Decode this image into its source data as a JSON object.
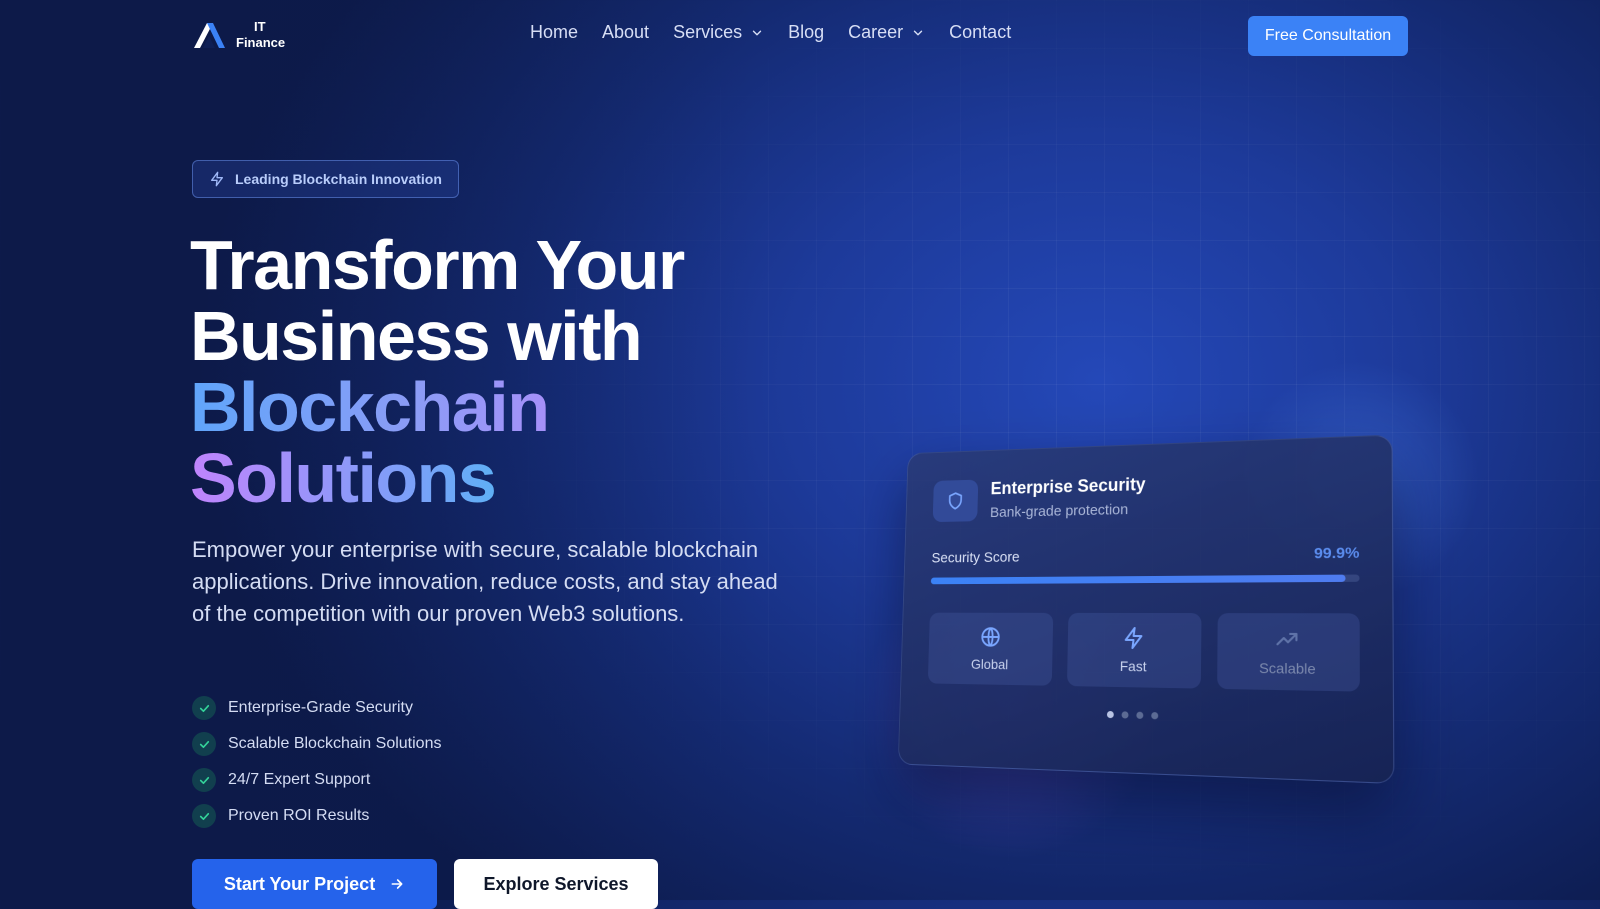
{
  "brand": {
    "line1": "IT",
    "line2": "Finance"
  },
  "nav": {
    "items": [
      {
        "label": "Home",
        "dropdown": false
      },
      {
        "label": "About",
        "dropdown": false
      },
      {
        "label": "Services",
        "dropdown": true
      },
      {
        "label": "Blog",
        "dropdown": false
      },
      {
        "label": "Career",
        "dropdown": true
      },
      {
        "label": "Contact",
        "dropdown": false
      }
    ],
    "cta_label": "Free Consultation"
  },
  "hero": {
    "badge": "Leading Blockchain Innovation",
    "headline": {
      "line1": "Transform Your",
      "line2": "Business with",
      "line3": "Blockchain",
      "line4": "Solutions"
    },
    "subtext": "Empower your enterprise with secure, scalable blockchain applications. Drive innovation, reduce costs, and stay ahead of the competition with our proven Web3 solutions.",
    "features": [
      "Enterprise-Grade Security",
      "Scalable Blockchain Solutions",
      "24/7 Expert Support",
      "Proven ROI Results"
    ],
    "primary_cta": "Start Your Project",
    "secondary_cta": "Explore Services"
  },
  "card": {
    "title": "Enterprise Security",
    "subtitle": "Bank-grade protection",
    "score_label": "Security Score",
    "score_value": "99.9%",
    "score_fraction": 0.97,
    "tiles": [
      {
        "label": "Global",
        "icon": "globe-icon"
      },
      {
        "label": "Fast",
        "icon": "lightning-icon"
      },
      {
        "label": "Scalable",
        "icon": "trending-up-icon"
      }
    ],
    "carousel": {
      "count": 4,
      "active": 0
    }
  },
  "colors": {
    "accent": "#3b82f6",
    "primary_button": "#2563eb",
    "check": "#22c55e",
    "score": "#5b8def"
  }
}
